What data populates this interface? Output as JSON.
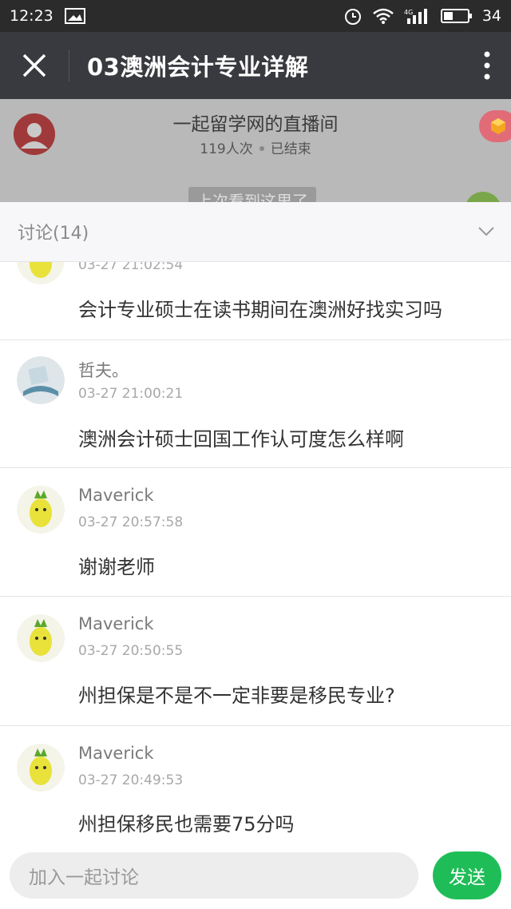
{
  "status_bar": {
    "time": "12:23",
    "battery": "34",
    "network": "4G"
  },
  "app_bar": {
    "title": "03澳洲会计专业详解"
  },
  "room": {
    "name": "一起留学网的直播间",
    "viewers": "119人次",
    "state": "已结束",
    "peek_text": "上次看到这里了"
  },
  "discussion": {
    "header": "讨论(14)",
    "items": [
      {
        "name": "",
        "time": "03-27 21:02:54",
        "message": "会计专业硕士在读书期间在澳洲好找实习吗",
        "avatar": "pineapple-avatar"
      },
      {
        "name": "哲夫。",
        "time": "03-27 21:00:21",
        "message": "澳洲会计硕士回国工作认可度怎么样啊",
        "avatar": "book-avatar"
      },
      {
        "name": "Maverick",
        "time": "03-27 20:57:58",
        "message": "谢谢老师",
        "avatar": "pineapple-avatar"
      },
      {
        "name": "Maverick",
        "time": "03-27 20:50:55",
        "message": "州担保是不是不一定非要是移民专业?",
        "avatar": "pineapple-avatar"
      },
      {
        "name": "Maverick",
        "time": "03-27 20:49:53",
        "message": "州担保移民也需要75分吗",
        "avatar": "pineapple-avatar"
      }
    ]
  },
  "input_bar": {
    "placeholder": "加入一起讨论",
    "send_label": "发送"
  },
  "colors": {
    "send_green": "#1fbd57",
    "app_bar": "#393a3f",
    "status_bar": "#2b2b2b"
  }
}
